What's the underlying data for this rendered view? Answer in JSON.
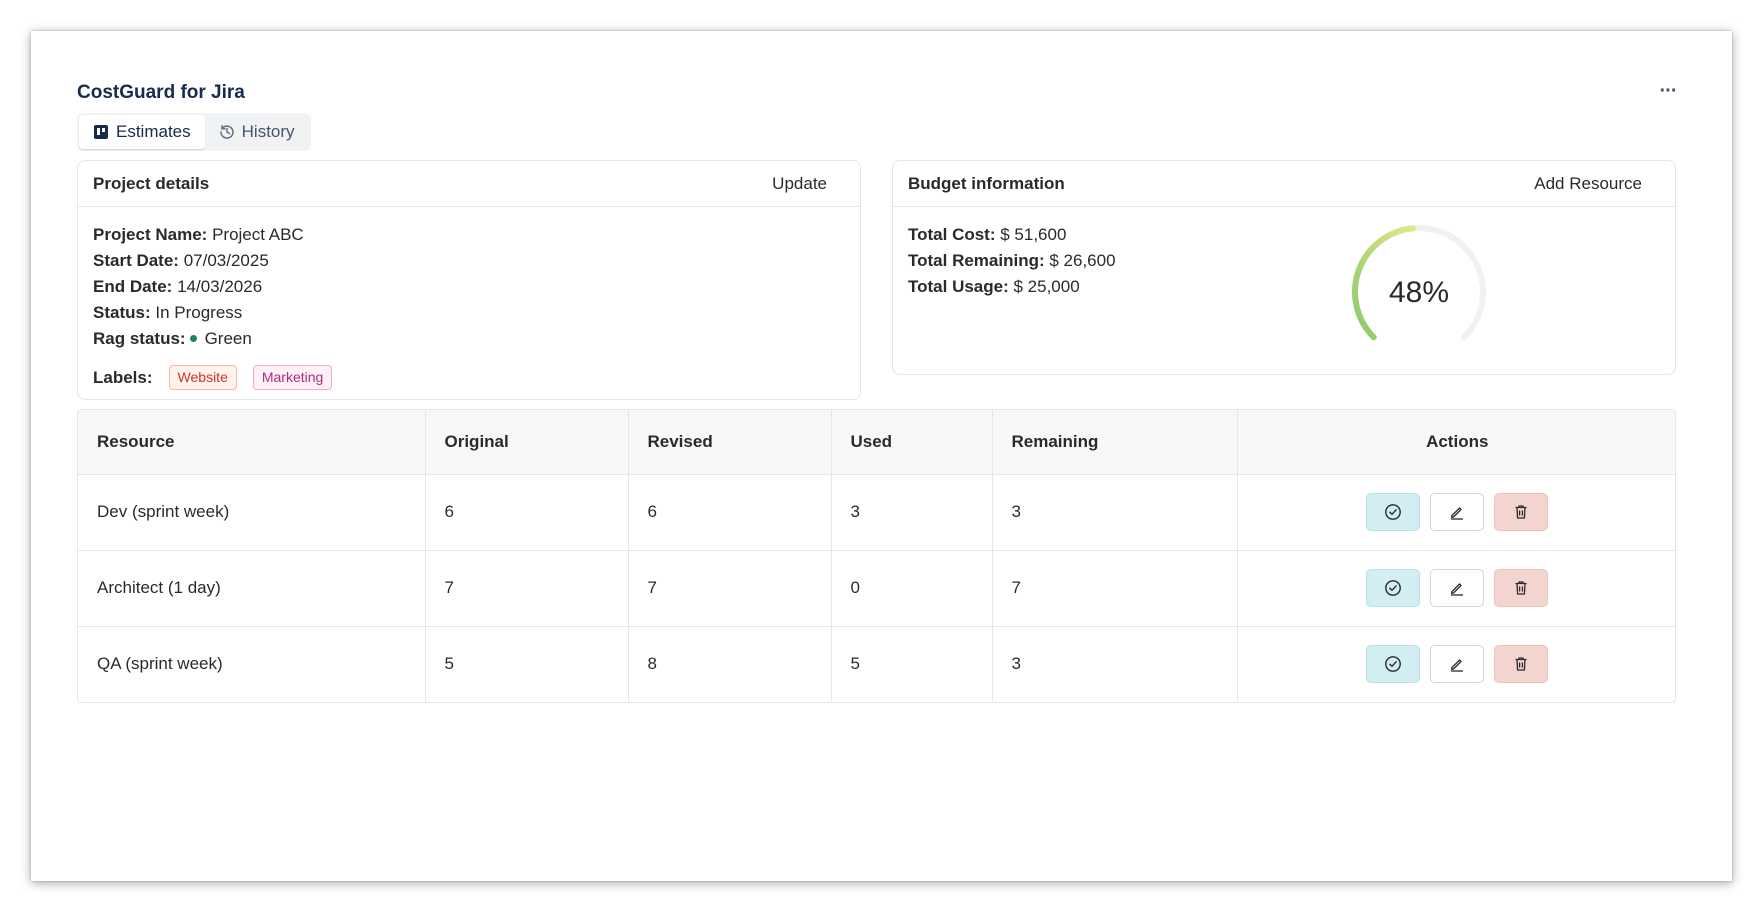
{
  "app": {
    "title": "CostGuard for Jira",
    "more_label": "···"
  },
  "tabs": [
    {
      "label": "Estimates",
      "icon": "board-icon",
      "active": true
    },
    {
      "label": "History",
      "icon": "history-icon",
      "active": false
    }
  ],
  "project": {
    "title": "Project details",
    "action_label": "Update",
    "fields": {
      "name_label": "Project Name:",
      "name": "Project ABC",
      "start_label": "Start Date:",
      "start": "07/03/2025",
      "end_label": "End Date:",
      "end": "14/03/2026",
      "status_label": "Status:",
      "status": "In Progress",
      "rag_label": "Rag status:",
      "rag": "Green"
    },
    "labels_label": "Labels:",
    "labels": [
      "Website",
      "Marketing"
    ]
  },
  "budget": {
    "title": "Budget information",
    "action_label": "Add Resource",
    "total_cost_label": "Total Cost:",
    "total_cost": "$ 51,600",
    "total_remaining_label": "Total Remaining:",
    "total_remaining": "$ 26,600",
    "total_usage_label": "Total Usage:",
    "total_usage": "$ 25,000",
    "usage_percent": 48,
    "usage_percent_label": "48%"
  },
  "table": {
    "headers": [
      "Resource",
      "Original",
      "Revised",
      "Used",
      "Remaining",
      "Actions"
    ],
    "rows": [
      [
        "Dev (sprint week)",
        "6",
        "6",
        "3",
        "3"
      ],
      [
        "Architect (1 day)",
        "7",
        "7",
        "0",
        "7"
      ],
      [
        "QA (sprint week)",
        "5",
        "8",
        "5",
        "3"
      ]
    ]
  },
  "colors": {
    "rag_green": "#1f845a",
    "approve_bg": "#d3eef2",
    "delete_bg": "#f4d4cf",
    "gauge_start": "#8bc96a",
    "gauge_end": "#e4e68b",
    "gauge_track": "#f1f1f1"
  }
}
